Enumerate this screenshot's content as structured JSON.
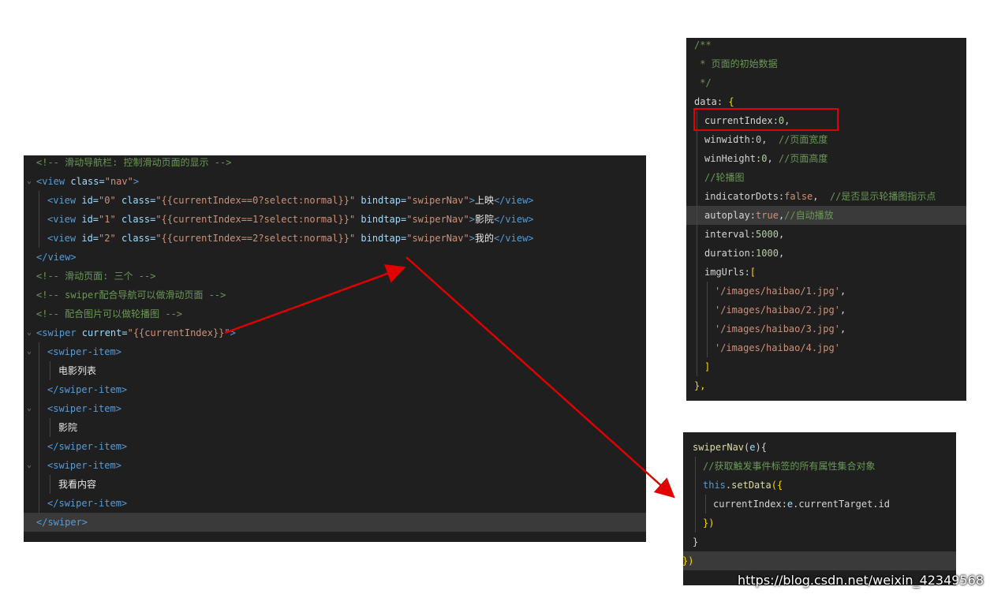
{
  "left_editor": {
    "lines": [
      {
        "indent": 0,
        "gutter": "",
        "parts": [
          {
            "t": "<!-- 滑动导航栏: 控制滑动页面的显示 -->",
            "c": "c-cm"
          }
        ]
      },
      {
        "indent": 0,
        "gutter": "⌄",
        "parts": [
          {
            "t": "<view ",
            "c": "c-tag"
          },
          {
            "t": "class=",
            "c": "c-attr"
          },
          {
            "t": "\"nav\"",
            "c": "c-str"
          },
          {
            "t": ">",
            "c": "c-tag"
          }
        ]
      },
      {
        "indent": 1,
        "gutter": "",
        "parts": [
          {
            "t": "<view ",
            "c": "c-tag"
          },
          {
            "t": "id=",
            "c": "c-attr"
          },
          {
            "t": "\"0\" ",
            "c": "c-str"
          },
          {
            "t": "class=",
            "c": "c-attr"
          },
          {
            "t": "\"{{",
            "c": "c-str"
          },
          {
            "t": "currentIndex==0?select:normal",
            "c": "c-str"
          },
          {
            "t": "}}\" ",
            "c": "c-str"
          },
          {
            "t": "bindtap=",
            "c": "c-attr"
          },
          {
            "t": "\"swiperNav\"",
            "c": "c-str"
          },
          {
            "t": ">",
            "c": "c-tag"
          },
          {
            "t": "上映",
            "c": "c-white"
          },
          {
            "t": "</view>",
            "c": "c-tag"
          }
        ]
      },
      {
        "indent": 1,
        "gutter": "",
        "parts": [
          {
            "t": "<view ",
            "c": "c-tag"
          },
          {
            "t": "id=",
            "c": "c-attr"
          },
          {
            "t": "\"1\" ",
            "c": "c-str"
          },
          {
            "t": "class=",
            "c": "c-attr"
          },
          {
            "t": "\"{{",
            "c": "c-str"
          },
          {
            "t": "currentIndex==1?select:normal",
            "c": "c-str"
          },
          {
            "t": "}}\" ",
            "c": "c-str"
          },
          {
            "t": "bindtap=",
            "c": "c-attr"
          },
          {
            "t": "\"swiperNav\"",
            "c": "c-str"
          },
          {
            "t": ">",
            "c": "c-tag"
          },
          {
            "t": "影院",
            "c": "c-white"
          },
          {
            "t": "</view>",
            "c": "c-tag"
          }
        ]
      },
      {
        "indent": 1,
        "gutter": "",
        "parts": [
          {
            "t": "<view ",
            "c": "c-tag"
          },
          {
            "t": "id=",
            "c": "c-attr"
          },
          {
            "t": "\"2\" ",
            "c": "c-str"
          },
          {
            "t": "class=",
            "c": "c-attr"
          },
          {
            "t": "\"{{",
            "c": "c-str"
          },
          {
            "t": "currentIndex==2?select:normal",
            "c": "c-str"
          },
          {
            "t": "}}\" ",
            "c": "c-str"
          },
          {
            "t": "bindtap=",
            "c": "c-attr"
          },
          {
            "t": "\"swiperNav\"",
            "c": "c-str"
          },
          {
            "t": ">",
            "c": "c-tag"
          },
          {
            "t": "我的",
            "c": "c-white"
          },
          {
            "t": "</view>",
            "c": "c-tag"
          }
        ]
      },
      {
        "indent": 0,
        "gutter": "",
        "parts": [
          {
            "t": "</view>",
            "c": "c-tag"
          }
        ]
      },
      {
        "indent": 0,
        "gutter": "",
        "parts": [
          {
            "t": "<!-- 滑动页面: 三个 -->",
            "c": "c-cm"
          }
        ]
      },
      {
        "indent": 0,
        "gutter": "",
        "parts": [
          {
            "t": "<!-- swiper配合导航可以做滑动页面 -->",
            "c": "c-cm"
          }
        ]
      },
      {
        "indent": 0,
        "gutter": "",
        "parts": [
          {
            "t": "<!-- 配合图片可以做轮播图 -->",
            "c": "c-cm"
          }
        ]
      },
      {
        "indent": 0,
        "gutter": "⌄",
        "parts": [
          {
            "t": "<swiper ",
            "c": "c-tag"
          },
          {
            "t": "current=",
            "c": "c-attr"
          },
          {
            "t": "\"{{currentIndex}}\"",
            "c": "c-str"
          },
          {
            "t": ">",
            "c": "c-tag"
          }
        ]
      },
      {
        "indent": 1,
        "gutter": "⌄",
        "parts": [
          {
            "t": "<swiper-item>",
            "c": "c-tag"
          }
        ]
      },
      {
        "indent": 2,
        "gutter": "",
        "parts": [
          {
            "t": "电影列表",
            "c": "c-white"
          }
        ]
      },
      {
        "indent": 1,
        "gutter": "",
        "parts": [
          {
            "t": "</swiper-item>",
            "c": "c-tag"
          }
        ]
      },
      {
        "indent": 1,
        "gutter": "⌄",
        "parts": [
          {
            "t": "<swiper-item>",
            "c": "c-tag"
          }
        ]
      },
      {
        "indent": 2,
        "gutter": "",
        "parts": [
          {
            "t": "影院",
            "c": "c-white"
          }
        ]
      },
      {
        "indent": 1,
        "gutter": "",
        "parts": [
          {
            "t": "</swiper-item>",
            "c": "c-tag"
          }
        ]
      },
      {
        "indent": 1,
        "gutter": "⌄",
        "parts": [
          {
            "t": "<swiper-item>",
            "c": "c-tag"
          }
        ]
      },
      {
        "indent": 2,
        "gutter": "",
        "parts": [
          {
            "t": "我看内容",
            "c": "c-white"
          }
        ]
      },
      {
        "indent": 1,
        "gutter": "",
        "parts": [
          {
            "t": "</swiper-item>",
            "c": "c-tag"
          }
        ]
      },
      {
        "indent": 0,
        "gutter": "",
        "hl": true,
        "parts": [
          {
            "t": "</swiper>",
            "c": "c-tag"
          }
        ]
      }
    ]
  },
  "top_right_editor": {
    "lines": [
      {
        "indent": 0,
        "parts": [
          {
            "t": "/**",
            "c": "c-cm"
          }
        ]
      },
      {
        "indent": 0,
        "parts": [
          {
            "t": " * 页面的初始数据",
            "c": "c-cm"
          }
        ]
      },
      {
        "indent": 0,
        "parts": [
          {
            "t": " */",
            "c": "c-cm"
          }
        ]
      },
      {
        "indent": 0,
        "parts": [
          {
            "t": "data: ",
            "c": "c-plain"
          },
          {
            "t": "{",
            "c": "c-br"
          }
        ]
      },
      {
        "indent": 1,
        "parts": [
          {
            "t": "currentIndex:",
            "c": "c-plain"
          },
          {
            "t": "0",
            "c": "c-num"
          },
          {
            "t": ",",
            "c": "c-plain"
          }
        ]
      },
      {
        "indent": 1,
        "parts": [
          {
            "t": "winwidth:",
            "c": "c-plain"
          },
          {
            "t": "0",
            "c": "c-num"
          },
          {
            "t": ",  ",
            "c": "c-plain"
          },
          {
            "t": "//页面宽度",
            "c": "c-cm"
          }
        ]
      },
      {
        "indent": 1,
        "parts": [
          {
            "t": "winHeight:",
            "c": "c-plain"
          },
          {
            "t": "0",
            "c": "c-num"
          },
          {
            "t": ", ",
            "c": "c-plain"
          },
          {
            "t": "//页面高度",
            "c": "c-cm"
          }
        ]
      },
      {
        "indent": 1,
        "parts": [
          {
            "t": "//轮播图",
            "c": "c-cm"
          }
        ]
      },
      {
        "indent": 1,
        "parts": [
          {
            "t": "indicatorDots:",
            "c": "c-plain"
          },
          {
            "t": "false",
            "c": "c-str"
          },
          {
            "t": ",  ",
            "c": "c-plain"
          },
          {
            "t": "//是否显示轮播图指示点",
            "c": "c-cm"
          }
        ]
      },
      {
        "indent": 1,
        "hl": true,
        "parts": [
          {
            "t": "autoplay:",
            "c": "c-plain"
          },
          {
            "t": "true",
            "c": "c-str"
          },
          {
            "t": ",",
            "c": "c-plain"
          },
          {
            "t": "//自动播放",
            "c": "c-cm"
          }
        ]
      },
      {
        "indent": 1,
        "parts": [
          {
            "t": "interval:",
            "c": "c-plain"
          },
          {
            "t": "5000",
            "c": "c-num"
          },
          {
            "t": ",",
            "c": "c-plain"
          }
        ]
      },
      {
        "indent": 1,
        "parts": [
          {
            "t": "duration:",
            "c": "c-plain"
          },
          {
            "t": "1000",
            "c": "c-num"
          },
          {
            "t": ",",
            "c": "c-plain"
          }
        ]
      },
      {
        "indent": 1,
        "parts": [
          {
            "t": "imgUrls:",
            "c": "c-plain"
          },
          {
            "t": "[",
            "c": "c-br"
          }
        ]
      },
      {
        "indent": 2,
        "parts": [
          {
            "t": "'/images/haibao/1.jpg'",
            "c": "c-str"
          },
          {
            "t": ",",
            "c": "c-plain"
          }
        ]
      },
      {
        "indent": 2,
        "parts": [
          {
            "t": "'/images/haibao/2.jpg'",
            "c": "c-str"
          },
          {
            "t": ",",
            "c": "c-plain"
          }
        ]
      },
      {
        "indent": 2,
        "parts": [
          {
            "t": "'/images/haibao/3.jpg'",
            "c": "c-str"
          },
          {
            "t": ",",
            "c": "c-plain"
          }
        ]
      },
      {
        "indent": 2,
        "parts": [
          {
            "t": "'/images/haibao/4.jpg'",
            "c": "c-str"
          }
        ]
      },
      {
        "indent": 1,
        "parts": [
          {
            "t": "]",
            "c": "c-br"
          }
        ]
      },
      {
        "indent": 0,
        "parts": [
          {
            "t": "},",
            "c": "c-br"
          }
        ]
      }
    ]
  },
  "bottom_right_editor": {
    "lines": [
      {
        "indent": 0,
        "parts": [
          {
            "t": "swiperNav",
            "c": "c-fn"
          },
          {
            "t": "(",
            "c": "c-plain"
          },
          {
            "t": "e",
            "c": "c-var"
          },
          {
            "t": "){",
            "c": "c-plain"
          }
        ]
      },
      {
        "indent": 1,
        "parts": [
          {
            "t": "//获取触发事件标签的所有属性集合对象",
            "c": "c-cm"
          }
        ]
      },
      {
        "indent": 1,
        "parts": [
          {
            "t": "this",
            "c": "c-kw"
          },
          {
            "t": ".",
            "c": "c-plain"
          },
          {
            "t": "setData",
            "c": "c-fn"
          },
          {
            "t": "({",
            "c": "c-br"
          }
        ]
      },
      {
        "indent": 2,
        "parts": [
          {
            "t": "currentIndex:",
            "c": "c-plain"
          },
          {
            "t": "e",
            "c": "c-var"
          },
          {
            "t": ".currentTarget.id",
            "c": "c-plain"
          }
        ]
      },
      {
        "indent": 1,
        "parts": [
          {
            "t": "})",
            "c": "c-br"
          }
        ]
      },
      {
        "indent": 0,
        "parts": [
          {
            "t": "}",
            "c": "c-plain"
          }
        ]
      },
      {
        "indent": -1,
        "hl": true,
        "parts": [
          {
            "t": "})",
            "c": "c-br"
          }
        ]
      }
    ]
  },
  "watermark": "https://blog.csdn.net/weixin_42349568",
  "colors": {
    "annotation_red": "#e00000",
    "editor_bg": "#1f1f1f",
    "page_bg": "#ffffff"
  }
}
